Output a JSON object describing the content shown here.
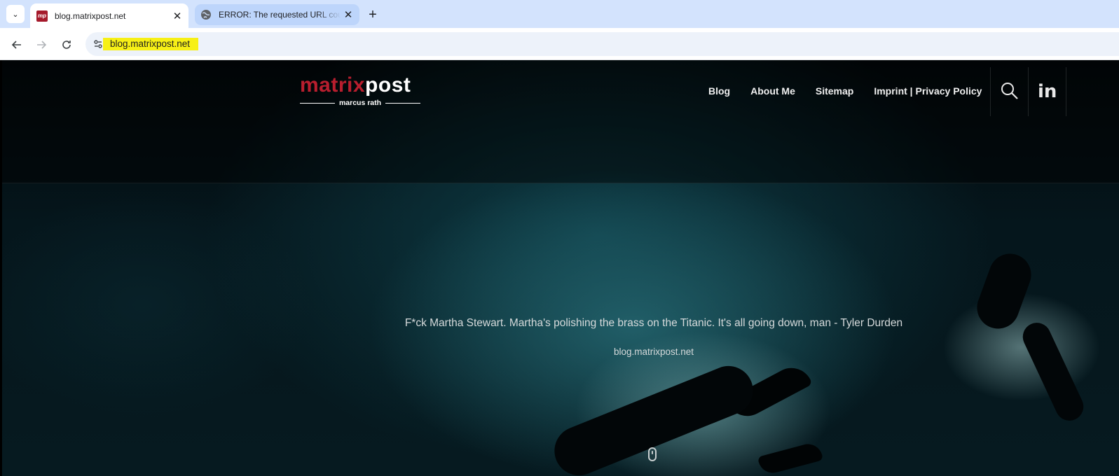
{
  "browser": {
    "tabs": [
      {
        "title": "blog.matrixpost.net",
        "favicon": "mp",
        "active": true
      },
      {
        "title": "ERROR: The requested URL could not be retrieved",
        "favicon": "globe-icon",
        "active": false
      }
    ],
    "new_tab": "+",
    "close": "✕",
    "url": "blog.matrixpost.net",
    "tab_search": "⌄"
  },
  "site": {
    "logo_main_1": "matrix",
    "logo_main_2": "post",
    "logo_sub": "marcus rath",
    "nav": [
      "Blog",
      "About Me",
      "Sitemap",
      "Imprint | Privacy Policy"
    ],
    "linkedin": "in",
    "quote": "F*ck Martha Stewart. Martha's polishing the brass on the Titanic. It's all going down, man - Tyler Durden",
    "site_name": "blog.matrixpost.net"
  },
  "colors": {
    "tabstrip": "#d3e3fd",
    "url_highlight": "#f7f016",
    "brand_red": "#b81e2e"
  }
}
